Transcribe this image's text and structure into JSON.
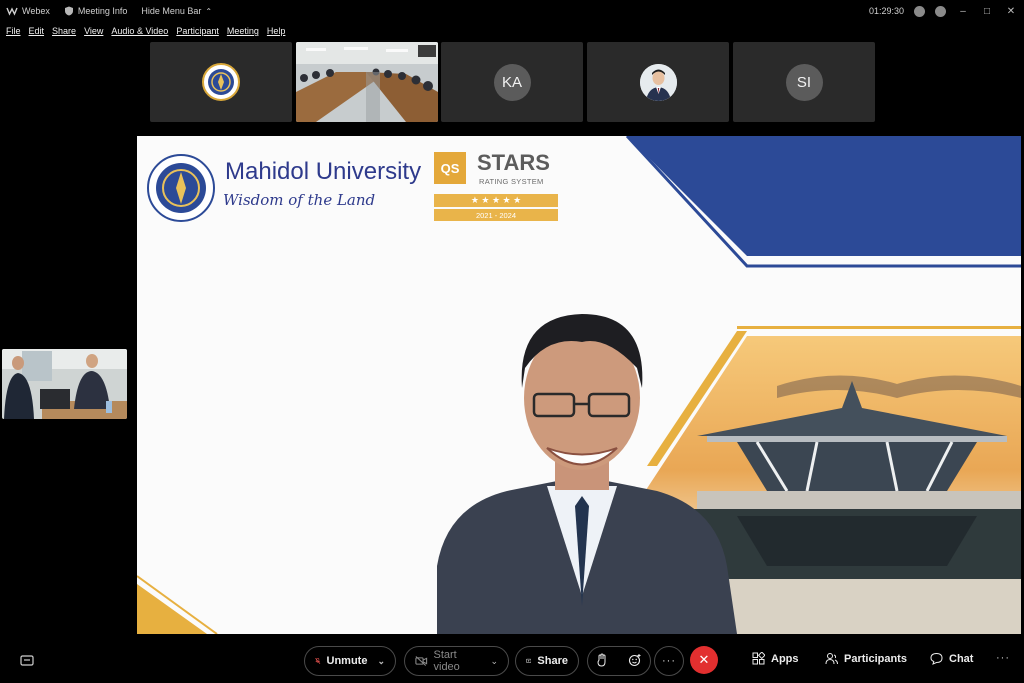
{
  "titlebar": {
    "app_name": "Webex",
    "meeting_info": "Meeting Info",
    "hide_menu_bar": "Hide Menu Bar",
    "clock": "01:29:30"
  },
  "menu": [
    "File",
    "Edit",
    "Share",
    "View",
    "Audio & Video",
    "Participant",
    "Meeting",
    "Help"
  ],
  "thumbnails": [
    {
      "kind": "logo"
    },
    {
      "kind": "video-room"
    },
    {
      "kind": "initials",
      "initials": "KA"
    },
    {
      "kind": "photo"
    },
    {
      "kind": "initials",
      "initials": "SI"
    }
  ],
  "slide": {
    "university": "Mahidol University",
    "tagline": "Wisdom of the Land",
    "qs_badge": "QS",
    "stars_title": "STARS",
    "rating_system": "RATING SYSTEM",
    "stars": "★ ★ ★ ★ ★",
    "years": "2021 - 2024",
    "colors": {
      "navy": "#2c4a97",
      "gold": "#e7b040",
      "brand_text": "#2e3a8c"
    }
  },
  "controls": {
    "unmute": "Unmute",
    "start_video": "Start video",
    "share": "Share",
    "apps": "Apps",
    "participants": "Participants",
    "chat": "Chat",
    "end_color": "#e22f2f"
  }
}
